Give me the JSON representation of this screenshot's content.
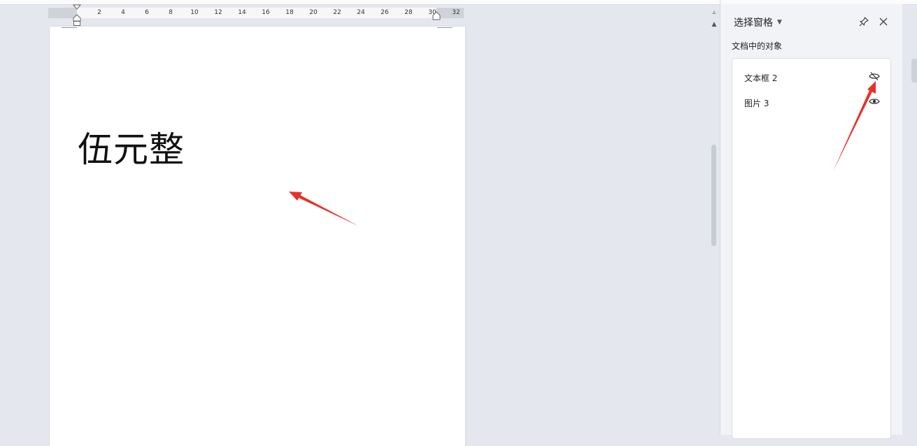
{
  "ruler": {
    "ticks": [
      "2",
      "4",
      "6",
      "8",
      "10",
      "12",
      "14",
      "16",
      "18",
      "20",
      "22",
      "24",
      "26",
      "28",
      "30",
      "32"
    ]
  },
  "document": {
    "text": "伍元整"
  },
  "panel": {
    "title": "选择窗格",
    "section_label": "文档中的对象",
    "objects": [
      {
        "label": "文本框 2",
        "visibility": "hidden",
        "icon": "eye-off-icon"
      },
      {
        "label": "图片 3",
        "visibility": "visible",
        "icon": "eye-icon"
      }
    ]
  },
  "colors": {
    "annotation_arrow": "#e8302a",
    "page": "#ffffff",
    "workspace": "#e4e7ee",
    "panel": "#f1f3f6"
  }
}
